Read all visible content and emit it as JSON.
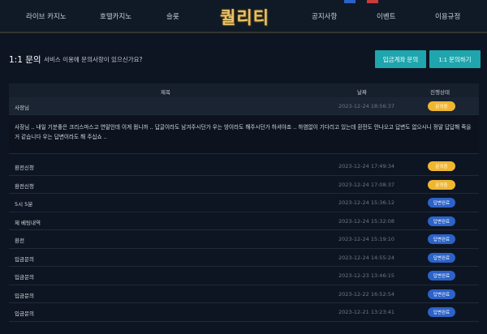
{
  "nav": {
    "items": [
      "라이브 카지노",
      "호텔카지노",
      "슬롯",
      "공지사항",
      "이벤트",
      "이용규정"
    ],
    "logo": "퀄리티"
  },
  "heading": {
    "title": "1:1 문의",
    "subtitle": "서비스 이용에 문의사항이 있으신가요?",
    "btn_account": "입금계좌 문의",
    "btn_inquire": "1:1 문의하기"
  },
  "table": {
    "headers": {
      "title": "제목",
      "date": "날짜",
      "status": "진행상태"
    },
    "expanded": {
      "title": "사장님",
      "date": "2023-12-24 18:56:37",
      "status": "문의중",
      "content": "사장님 .. 내일 기분좋은 크리스마스고 연말인데 이게 뭡니까 .. 답글이라도 남겨주시던가 우는 방이라도 해주시던가 하셔야죠 .. 하염없이 기다리고 있는데 환전도 안나오고 답변도 없으시니 정말 답답해 죽을거 같습니다 우는 답변이라도 해 주십쇼 .."
    },
    "rows": [
      {
        "title": "환전신청",
        "date": "2023-12-24 17:49:34",
        "status": "문의중",
        "kind": "waiting"
      },
      {
        "title": "환전신청",
        "date": "2023-12-24 17:08:37",
        "status": "문의중",
        "kind": "waiting"
      },
      {
        "title": "5시 5분",
        "date": "2023-12-24 15:36:12",
        "status": "답변완료",
        "kind": "done"
      },
      {
        "title": "제 베팅내역",
        "date": "2023-12-24 15:32:08",
        "status": "답변완료",
        "kind": "done"
      },
      {
        "title": "환전",
        "date": "2023-12-24 15:19:10",
        "status": "답변완료",
        "kind": "done"
      },
      {
        "title": "입금문의",
        "date": "2023-12-24 14:55:24",
        "status": "답변완료",
        "kind": "done"
      },
      {
        "title": "입금문의",
        "date": "2023-12-23 13:46:15",
        "status": "답변완료",
        "kind": "done"
      },
      {
        "title": "입금문의",
        "date": "2023-12-22 16:52:54",
        "status": "답변완료",
        "kind": "done"
      },
      {
        "title": "입금문의",
        "date": "2023-12-21 13:23:41",
        "status": "답변완료",
        "kind": "done"
      }
    ]
  },
  "colors": {
    "waiting": "#f1b631",
    "done": "#2c63c9",
    "teal": "#1ea5ad",
    "logo": "#e6c36a"
  }
}
